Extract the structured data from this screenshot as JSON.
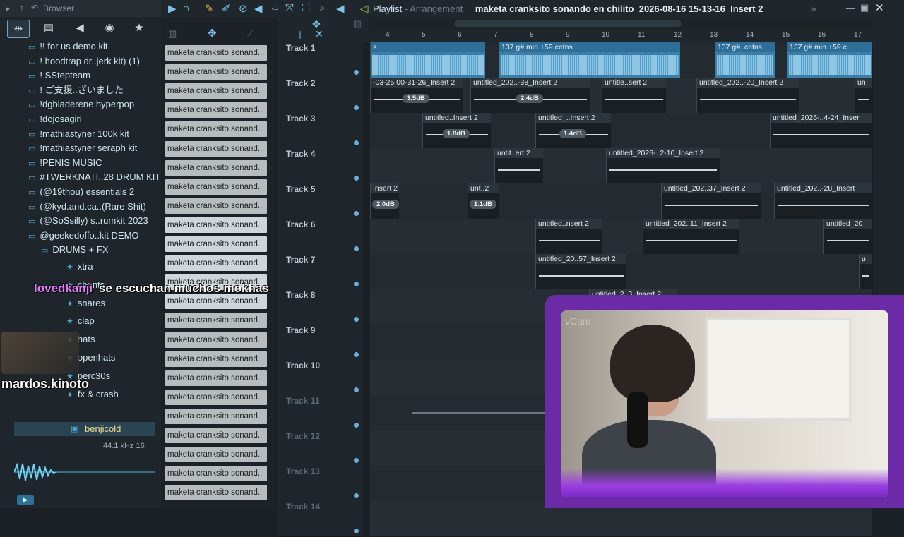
{
  "toolbar": {
    "playlist_label": "Playlist",
    "arrangement_label": "Arrangement",
    "project_title": "maketa cranksito sonando en chilito_2026-08-16 15-13-16_Insert 2"
  },
  "browser": {
    "title": "Browser",
    "items": [
      {
        "label": "!! for us demo kit"
      },
      {
        "label": "! hoodtrap dr..jerk kit) (1)"
      },
      {
        "label": "! SStepteam"
      },
      {
        "label": "! ご支援..ざいました"
      },
      {
        "label": "!dgbladerene hyperpop"
      },
      {
        "label": "!dojosagiri"
      },
      {
        "label": "!mathiastyner 100k kit"
      },
      {
        "label": "!mathiastyner seraph kit"
      },
      {
        "label": "!PENIS MUSIC"
      },
      {
        "label": "#TWERKNATI..28 DRUM KIT"
      },
      {
        "label": "(@19thou) essentials 2"
      },
      {
        "label": "(@kyd.and.ca..(Rare Shit)"
      },
      {
        "label": "(@SoSsilly) s..rumkit 2023"
      },
      {
        "label": "@geekedoffo..kit DEMO"
      },
      {
        "label": "DRUMS + FX"
      }
    ],
    "subitems": [
      "xtra",
      "chants",
      "snares",
      "clap",
      "hats",
      "openhats",
      "perc30s",
      "fx & crash"
    ],
    "selected_file": "benjicold",
    "sample_rate": "44.1 kHz 16"
  },
  "patterns": {
    "label": "maketa cranksito sonand..",
    "count": 24
  },
  "ruler": {
    "bars": [
      "4",
      "5",
      "6",
      "7",
      "8",
      "9",
      "10",
      "11",
      "12",
      "13",
      "14",
      "15",
      "16",
      "17"
    ]
  },
  "tracks": [
    {
      "name": "Track 1"
    },
    {
      "name": "Track 2"
    },
    {
      "name": "Track 3"
    },
    {
      "name": "Track 4"
    },
    {
      "name": "Track 5"
    },
    {
      "name": "Track 6"
    },
    {
      "name": "Track 7"
    },
    {
      "name": "Track 8"
    },
    {
      "name": "Track 9"
    },
    {
      "name": "Track 10"
    },
    {
      "name": "Track 11"
    },
    {
      "name": "Track 12"
    },
    {
      "name": "Track 13"
    },
    {
      "name": "Track 14"
    }
  ],
  "clips": {
    "t1a": "s",
    "t1b": "137 g# min +59 cetns",
    "t1c": "137 g#..cetns",
    "t1d": "137 g# min +59 c",
    "t2a": "-03-25 00-31-26_Insert 2",
    "t2a_db": "3.5dB",
    "t2b": "untitled_202..-38_Insert 2",
    "t2b_db": "2.4dB",
    "t2c": "untitle..sert 2",
    "t2d": "untitled_202..-20_Insert 2",
    "t2e": "un",
    "t3a": "untitled..Insert 2",
    "t3a_db": "1.8dB",
    "t3b": "untitled_..Insert 2",
    "t3b_db": "1.4dB",
    "t3c": "untitled_2026-..4-24_Inser",
    "t4a": "untit..ert 2",
    "t4b": "untitled_2026-..2-10_Insert 2",
    "t5a": "Insert 2",
    "t5a_db": "2.0dB",
    "t5b": "unt..2",
    "t5b_db": "1.1dB",
    "t5c": "untitled_202..37_Insert 2",
    "t5d": "untitled_202..-28_Insert",
    "t6a": "untitled..nsert 2",
    "t6b": "untitled_202..11_Insert 2",
    "t6c": "untitled_20",
    "t7a": "untitled_20..57_Insert 2",
    "t7b": "u",
    "t8a": "untitled_2..3_Insert 2"
  },
  "overlay": {
    "chat1_user": "lovedkanji",
    "chat1_msg": "se escuchan muchos mokhas",
    "chat2_user": "mardos.kinoto",
    "cam_label": "vCam"
  },
  "colors": {
    "accent": "#6ab0dc",
    "clip_blue": "#3c7ea8",
    "overlay_purple": "#6b2aa6"
  }
}
